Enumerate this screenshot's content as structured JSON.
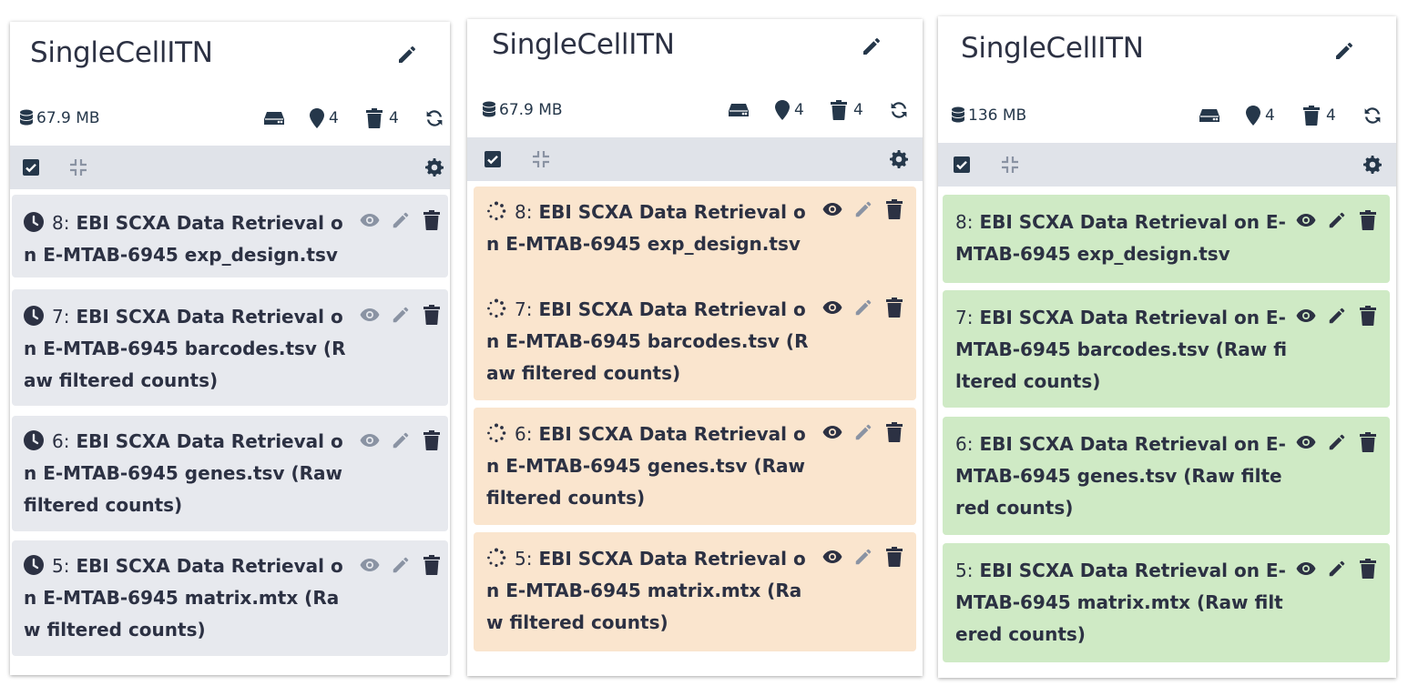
{
  "panels": [
    {
      "title": "SingleCellITN",
      "size": "67.9 MB",
      "deleted_count": "4",
      "hidden_count": "4",
      "state": "queued",
      "items": [
        {
          "hid": "8:",
          "name": "EBI SCXA Data Retrieval on E-MTAB-6945 exp_design.tsv"
        },
        {
          "hid": "7:",
          "name": "EBI SCXA Data Retrieval on E-MTAB-6945 barcodes.tsv (Raw filtered counts)"
        },
        {
          "hid": "6:",
          "name": "EBI SCXA Data Retrieval on E-MTAB-6945 genes.tsv (Raw filtered counts)"
        },
        {
          "hid": "5:",
          "name": "EBI SCXA Data Retrieval on E-MTAB-6945 matrix.mtx (Raw filtered counts)"
        }
      ]
    },
    {
      "title": "SingleCellITN",
      "size": "67.9 MB",
      "deleted_count": "4",
      "hidden_count": "4",
      "state": "running",
      "items": [
        {
          "hid": "8:",
          "name": "EBI SCXA Data Retrieval on E-MTAB-6945 exp_design.tsv"
        },
        {
          "hid": "7:",
          "name": "EBI SCXA Data Retrieval on E-MTAB-6945 barcodes.tsv (Raw filtered counts)"
        },
        {
          "hid": "6:",
          "name": "EBI SCXA Data Retrieval on E-MTAB-6945 genes.tsv (Raw filtered counts)"
        },
        {
          "hid": "5:",
          "name": "EBI SCXA Data Retrieval on E-MTAB-6945 matrix.mtx (Raw filtered counts)"
        }
      ]
    },
    {
      "title": "SingleCellITN",
      "size": "136 MB",
      "deleted_count": "4",
      "hidden_count": "4",
      "state": "ok",
      "items": [
        {
          "hid": "8:",
          "name": "EBI SCXA Data Retrieval on E-MTAB-6945 exp_design.tsv"
        },
        {
          "hid": "7:",
          "name": "EBI SCXA Data Retrieval on E-MTAB-6945 barcodes.tsv (Raw filtered counts)"
        },
        {
          "hid": "6:",
          "name": "EBI SCXA Data Retrieval on E-MTAB-6945 genes.tsv (Raw filtered counts)"
        },
        {
          "hid": "5:",
          "name": "EBI SCXA Data Retrieval on E-MTAB-6945 matrix.mtx (Raw filtered counts)"
        }
      ]
    }
  ],
  "colors": {
    "queued": "#e7e9ee",
    "running": "#fae5ce",
    "ok": "#cfeac5",
    "toolbar": "#e0e3e9",
    "text": "#2c3143"
  },
  "icons": {
    "edit": "pencil-icon",
    "size": "database-icon",
    "storage": "hard-drive-icon",
    "deleted": "map-marker-icon",
    "hidden": "trash-icon",
    "refresh": "sync-icon",
    "select": "check-square-icon",
    "collapse": "compress-icon",
    "settings": "gear-icon",
    "queued": "clock-icon",
    "running": "spinner-icon",
    "view": "eye-icon",
    "item_edit": "pencil-icon",
    "item_delete": "trash-icon"
  }
}
